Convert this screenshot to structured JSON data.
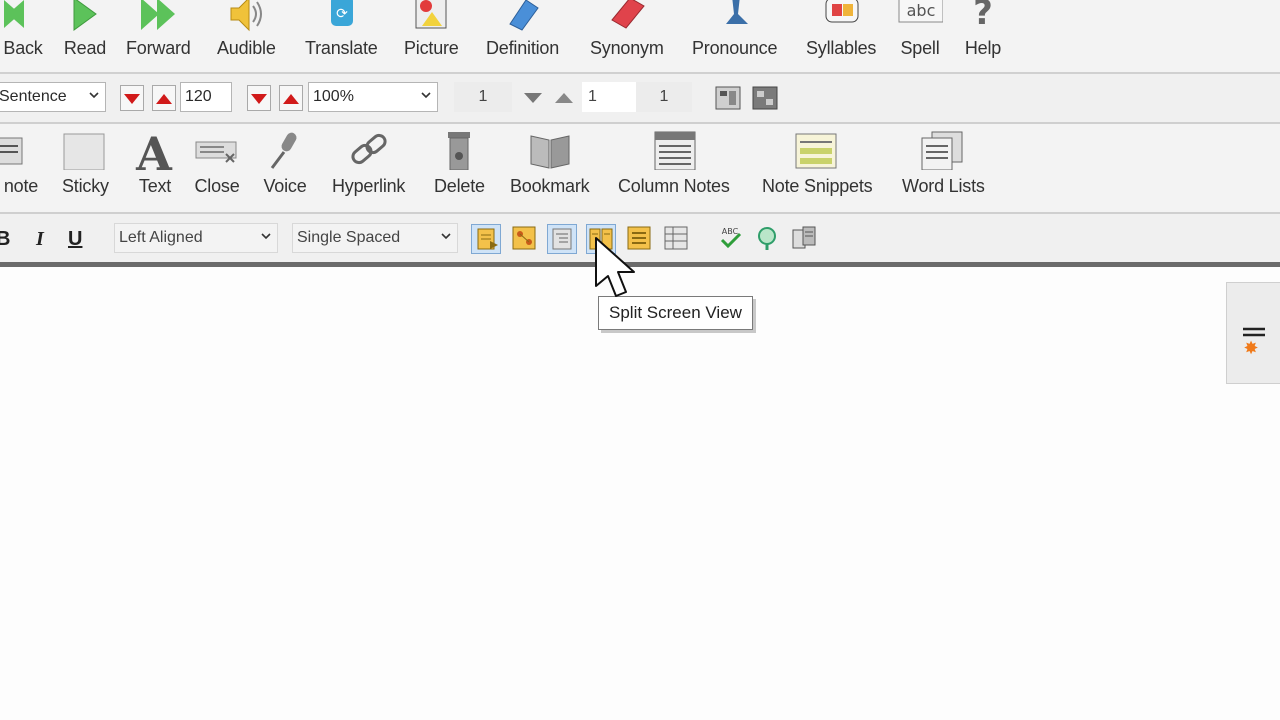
{
  "toolbar1": {
    "buttons": [
      {
        "label": "Back",
        "icon": "back-arrows-icon"
      },
      {
        "label": "Read",
        "icon": "play-arrow-icon"
      },
      {
        "label": "Forward",
        "icon": "forward-arrows-icon"
      },
      {
        "label": "Audible",
        "icon": "speaker-icon"
      },
      {
        "label": "Translate",
        "icon": "translate-globe-icon"
      },
      {
        "label": "Picture",
        "icon": "picture-icon"
      },
      {
        "label": "Definition",
        "icon": "definition-book-icon"
      },
      {
        "label": "Synonym",
        "icon": "synonym-book-icon"
      },
      {
        "label": "Pronounce",
        "icon": "pronounce-icon"
      },
      {
        "label": "Syllables",
        "icon": "syllables-icon"
      },
      {
        "label": "Spell",
        "icon": "spell-abc-icon"
      },
      {
        "label": "Help",
        "icon": "help-question-icon"
      }
    ]
  },
  "toolbar2": {
    "read_mode": "Sentence",
    "rate_value": "120",
    "zoom_value": "100%",
    "page_current": "1",
    "page_goto": "1",
    "page_total": "1"
  },
  "toolbar3": {
    "buttons": [
      {
        "label": "note",
        "icon": "footnote-icon"
      },
      {
        "label": "Sticky",
        "icon": "sticky-note-icon"
      },
      {
        "label": "Text",
        "icon": "text-a-icon"
      },
      {
        "label": "Close",
        "icon": "close-note-icon"
      },
      {
        "label": "Voice",
        "icon": "microphone-icon"
      },
      {
        "label": "Hyperlink",
        "icon": "chain-link-icon"
      },
      {
        "label": "Delete",
        "icon": "trash-can-icon"
      },
      {
        "label": "Bookmark",
        "icon": "open-book-icon"
      },
      {
        "label": "Column Notes",
        "icon": "column-notes-icon"
      },
      {
        "label": "Note Snippets",
        "icon": "note-snippets-icon"
      },
      {
        "label": "Word Lists",
        "icon": "word-lists-icon"
      }
    ]
  },
  "toolbar4": {
    "bold": "B",
    "italic": "I",
    "underline": "U",
    "alignment": "Left Aligned",
    "spacing": "Single Spaced"
  },
  "tooltip": "Split Screen View",
  "colors": {
    "toolbar_bg": "#f3f3f3",
    "highlight": "#cfe3f7",
    "arrow_red": "#d11a1a",
    "green": "#4caf50"
  }
}
